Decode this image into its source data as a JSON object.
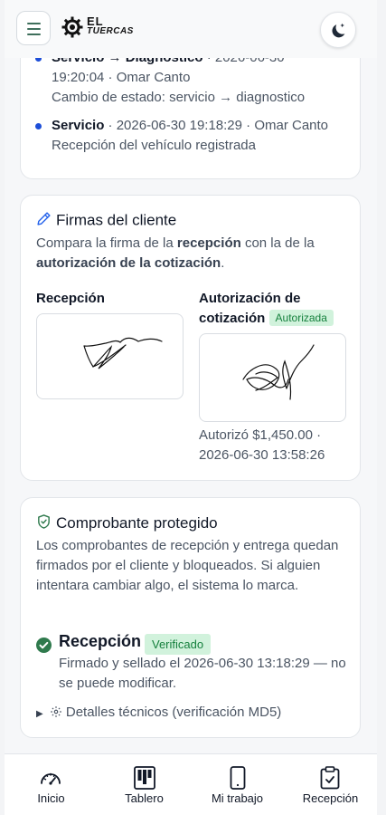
{
  "header": {
    "logo_line1": "EL",
    "logo_line2": "TUERCAS"
  },
  "history": {
    "entries": [
      {
        "title": "Servicio → Diagnostico",
        "meta_line1": " · 2026-06-30",
        "meta_line2": "19:20:04 · Omar Canto",
        "note": "Cambio de estado: servicio → diagnostico"
      },
      {
        "title": "Servicio",
        "meta_line1": " · 2026-06-30 19:18:29 · Omar Canto",
        "note": "Recepción del vehículo registrada"
      }
    ]
  },
  "signatures": {
    "title": "Firmas del cliente",
    "desc_part1": "Compara la firma de la ",
    "desc_bold1": "recepción",
    "desc_part2": " con la de la",
    "desc_bold2": "autorización de la cotización",
    "desc_part3": ".",
    "reception_label": "Recepción",
    "quote_label_line1": "Autorización de",
    "quote_label_line2": "cotización",
    "quote_badge": "Autorizada",
    "authorized_amount": "Autorizó $1,450.00 ·",
    "authorized_date": "2026-06-30 13:58:26"
  },
  "protected": {
    "title": "Comprobante protegido",
    "desc": "Los comprobantes de recepción y entrega quedan firmados por el cliente y bloqueados. Si alguien intentara cambiar algo, el sistema lo marca.",
    "verification_title": "Recepción",
    "verification_badge": "Verificado",
    "verification_desc": "Firmado y sellado el 2026-06-30 13:18:29 — no se puede modificar.",
    "details_label": "Detalles técnicos (verificación MD5)"
  },
  "bottom_nav": {
    "items": [
      {
        "label": "Inicio",
        "icon": "speedometer-icon"
      },
      {
        "label": "Tablero",
        "icon": "kanban-board-icon"
      },
      {
        "label": "Mi trabajo",
        "icon": "smartphone-icon"
      },
      {
        "label": "Recepción",
        "icon": "clipboard-check-icon"
      }
    ]
  },
  "colors": {
    "accent_green": "#2f7a4d",
    "badge_bg": "#d1f2dc",
    "badge_text": "#15803d",
    "timeline_dot": "#1d4ed8"
  }
}
